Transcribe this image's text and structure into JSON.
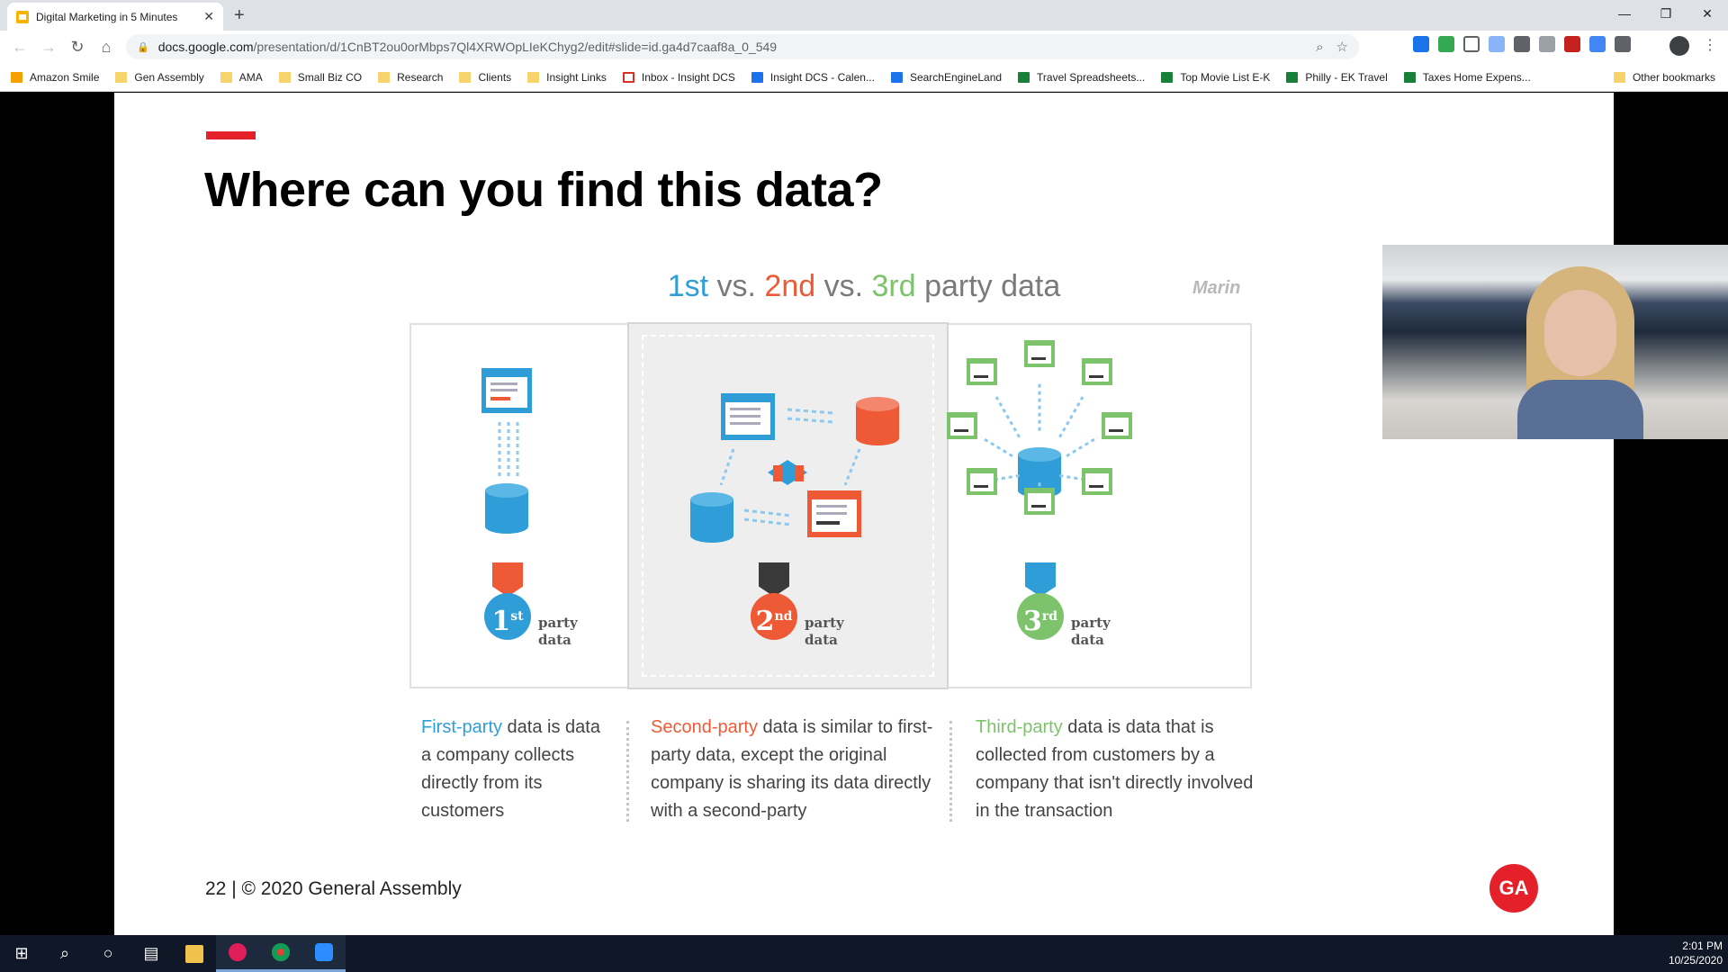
{
  "browser": {
    "tab_title": "Digital Marketing in 5 Minutes",
    "url_host": "docs.google.com",
    "url_path": "/presentation/d/1CnBT2ou0orMbps7Ql4XRWOpLIeKChyg2/edit#slide=id.ga4d7caaf8a_0_549",
    "bookmarks": [
      {
        "label": "Amazon Smile",
        "icon": "amazon-icon"
      },
      {
        "label": "Gen Assembly",
        "icon": "folder-icon"
      },
      {
        "label": "AMA",
        "icon": "folder-icon"
      },
      {
        "label": "Small Biz CO",
        "icon": "folder-icon"
      },
      {
        "label": "Research",
        "icon": "folder-icon"
      },
      {
        "label": "Clients",
        "icon": "folder-icon"
      },
      {
        "label": "Insight Links",
        "icon": "folder-icon"
      },
      {
        "label": "Inbox - Insight DCS",
        "icon": "gmail-icon"
      },
      {
        "label": "Insight DCS - Calen...",
        "icon": "calendar-icon"
      },
      {
        "label": "SearchEngineLand",
        "icon": "sel-icon"
      },
      {
        "label": "Travel Spreadsheets...",
        "icon": "sheets-icon"
      },
      {
        "label": "Top Movie List E-K",
        "icon": "sheets-icon"
      },
      {
        "label": "Philly - EK Travel",
        "icon": "sheets-icon"
      },
      {
        "label": "Taxes Home Expens...",
        "icon": "sheets-icon"
      }
    ],
    "other_bookmarks": "Other bookmarks"
  },
  "slide": {
    "title": "Where can you find this data?",
    "info_title": {
      "first": "1st",
      "vs1": " vs. ",
      "second": "2nd",
      "vs2": " vs. ",
      "third": "3rd",
      "rest": " party data"
    },
    "marin_logo": "Marin",
    "medals": [
      {
        "num": "1",
        "sup": "st",
        "label1": "party",
        "label2": "data",
        "color": "#2f9ed8",
        "ribbon": "#ef5a36"
      },
      {
        "num": "2",
        "sup": "nd",
        "label1": "party",
        "label2": "data",
        "color": "#ef5a36",
        "ribbon": "#3a3a3a"
      },
      {
        "num": "3",
        "sup": "rd",
        "label1": "party",
        "label2": "data",
        "color": "#7cc36b",
        "ribbon": "#2f9ed8"
      }
    ],
    "descriptions": [
      {
        "highlight": "First-party",
        "text": " data is data a company collects directly from its customers"
      },
      {
        "highlight": "Second-party",
        "text": " data is similar to first-party data, except the original company is sharing its data directly with a second-party"
      },
      {
        "highlight": "Third-party",
        "text": " data is data that is collected from customers by a company that isn't directly involved in the transaction"
      }
    ],
    "footer": "22 | © 2020 General Assembly",
    "ga_logo": "GA"
  },
  "taskbar": {
    "time": "2:01 PM",
    "date": "10/25/2020"
  },
  "colors": {
    "accent_red": "#e4202b",
    "first_blue": "#2f9ed8",
    "second_orange": "#ef5a36",
    "third_green": "#7cc36b"
  }
}
